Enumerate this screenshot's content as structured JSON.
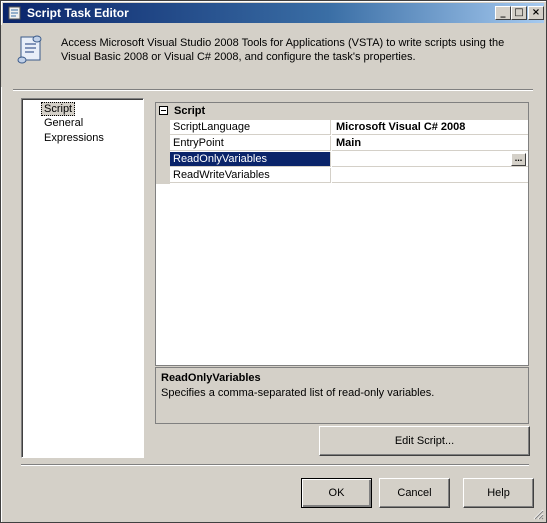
{
  "window": {
    "title": "Script Task Editor",
    "controls": {
      "minimize": "_",
      "maximize": "□",
      "close": "×"
    }
  },
  "header": {
    "icon": "script-scroll-icon",
    "description": "Access Microsoft Visual Studio 2008 Tools for Applications (VSTA) to write scripts using the Visual Basic 2008 or Visual C# 2008, and configure the task's properties."
  },
  "nav": {
    "items": [
      {
        "label": "Script",
        "selected": true
      },
      {
        "label": "General",
        "selected": false
      },
      {
        "label": "Expressions",
        "selected": false
      }
    ]
  },
  "properties": {
    "category": "Script",
    "rows": [
      {
        "name": "ScriptLanguage",
        "value": "Microsoft Visual C# 2008"
      },
      {
        "name": "EntryPoint",
        "value": "Main"
      },
      {
        "name": "ReadOnlyVariables",
        "value": "",
        "selected": true
      },
      {
        "name": "ReadWriteVariables",
        "value": ""
      }
    ],
    "ellipsis_label": "..."
  },
  "description_pane": {
    "title": "ReadOnlyVariables",
    "text": "Specifies a comma-separated list of read-only variables."
  },
  "buttons": {
    "edit_script": "Edit Script...",
    "ok": "OK",
    "cancel": "Cancel",
    "help": "Help"
  }
}
